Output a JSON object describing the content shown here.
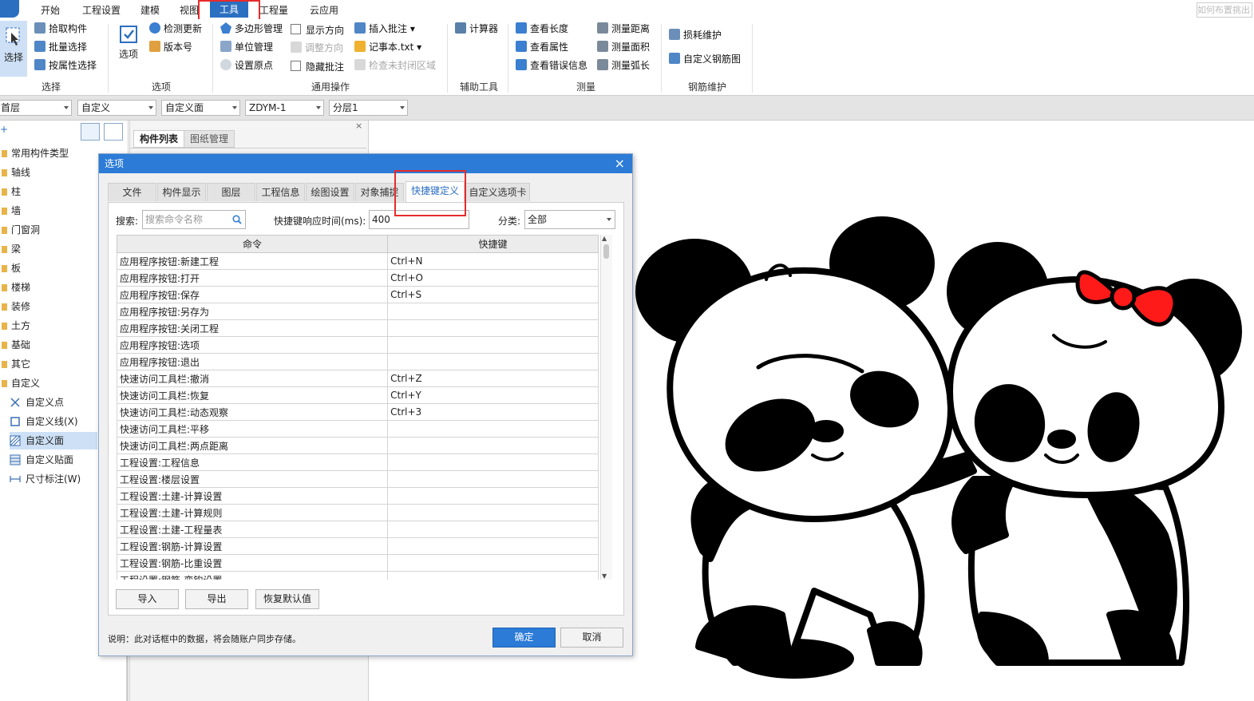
{
  "menubar": {
    "items": [
      "开始",
      "工程设置",
      "建模",
      "视图",
      "工具",
      "工程量",
      "云应用"
    ],
    "active": "工具",
    "search_placeholder": "如何布置挑出"
  },
  "ribbon": {
    "groups": {
      "select": {
        "label": "选择",
        "big": "选择",
        "items": [
          "拾取构件",
          "批量选择",
          "按属性选择"
        ]
      },
      "options": {
        "label": "选项",
        "big": "选项",
        "items": [
          "检测更新",
          "版本号"
        ]
      },
      "common": {
        "label": "通用操作",
        "items": [
          "多边形管理",
          "单位管理",
          "设置原点",
          "显示方向",
          "调整方向",
          "隐藏批注",
          "插入批注",
          "记事本.txt",
          "检查未封闭区域"
        ]
      },
      "aux": {
        "label": "辅助工具",
        "items": [
          "计算器"
        ]
      },
      "measure": {
        "label": "测量",
        "items": [
          "查看长度",
          "查看属性",
          "查看错误信息",
          "测量距离",
          "测量面积",
          "测量弧长"
        ]
      },
      "rebar": {
        "label": "钢筋维护",
        "items": [
          "损耗维护",
          "自定义钢筋图"
        ]
      }
    }
  },
  "toolbar": {
    "dropdowns": [
      "首层",
      "自定义",
      "自定义面",
      "ZDYM-1",
      "分层1"
    ]
  },
  "tree": {
    "categories": [
      "常用构件类型",
      "轴线",
      "柱",
      "墙",
      "门窗洞",
      "梁",
      "板",
      "楼梯",
      "装修",
      "土方",
      "基础",
      "其它",
      "自定义"
    ],
    "custom_items": [
      "自定义点",
      "自定义线(X)",
      "自定义面",
      "自定义贴面",
      "尺寸标注(W)"
    ],
    "selected": "自定义面"
  },
  "complist": {
    "tabs": [
      "构件列表",
      "图纸管理"
    ]
  },
  "dialog": {
    "title": "选项",
    "close": "×",
    "tabs": [
      "文件",
      "构件显示",
      "图层",
      "工程信息",
      "绘图设置",
      "对象捕捉",
      "快捷键定义",
      "自定义选项卡"
    ],
    "active_tab": "快捷键定义",
    "search_label": "搜索:",
    "search_placeholder": "搜索命令名称",
    "response_label": "快捷键响应时间(ms):",
    "response_value": "400",
    "category_label": "分类:",
    "category_value": "全部",
    "columns": [
      "命令",
      "快捷键"
    ],
    "rows": [
      [
        "应用程序按钮:新建工程",
        "Ctrl+N"
      ],
      [
        "应用程序按钮:打开",
        "Ctrl+O"
      ],
      [
        "应用程序按钮:保存",
        "Ctrl+S"
      ],
      [
        "应用程序按钮:另存为",
        ""
      ],
      [
        "应用程序按钮:关闭工程",
        ""
      ],
      [
        "应用程序按钮:选项",
        ""
      ],
      [
        "应用程序按钮:退出",
        ""
      ],
      [
        "快速访问工具栏:撤消",
        "Ctrl+Z"
      ],
      [
        "快速访问工具栏:恢复",
        "Ctrl+Y"
      ],
      [
        "快速访问工具栏:动态观察",
        "Ctrl+3"
      ],
      [
        "快速访问工具栏:平移",
        ""
      ],
      [
        "快速访问工具栏:两点距离",
        ""
      ],
      [
        "工程设置:工程信息",
        ""
      ],
      [
        "工程设置:楼层设置",
        ""
      ],
      [
        "工程设置:土建-计算设置",
        ""
      ],
      [
        "工程设置:土建-计算规则",
        ""
      ],
      [
        "工程设置:土建-工程量表",
        ""
      ],
      [
        "工程设置:钢筋-计算设置",
        ""
      ],
      [
        "工程设置:钢筋-比重设置",
        ""
      ],
      [
        "工程设置:钢筋-弯钩设置",
        ""
      ]
    ],
    "import_label": "导入",
    "export_label": "导出",
    "restore_label": "恢复默认值",
    "note": "说明：此对话框中的数据，将会随账户同步存储。",
    "ok_label": "确定",
    "cancel_label": "取消"
  },
  "colors": {
    "accent": "#2b7bd7",
    "highlight_box": "#e62b2b",
    "bow": "#ff1a1a"
  }
}
